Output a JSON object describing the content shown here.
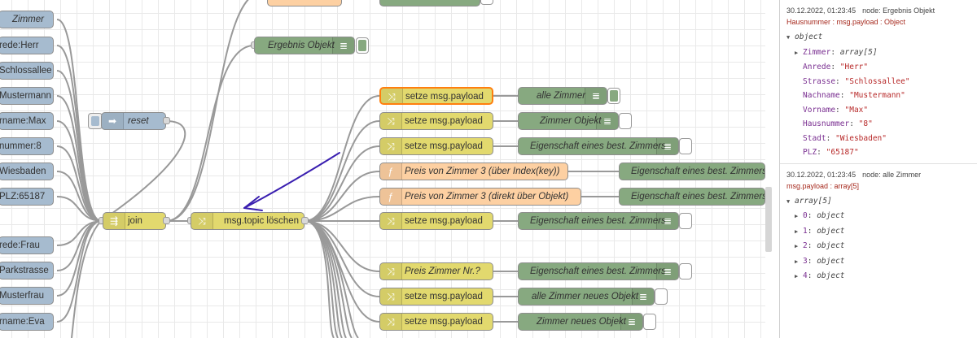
{
  "flow": {
    "inject_nodes": [
      "Zimmer",
      "rede:Herr",
      "Schlossallee",
      "Mustermann",
      "rname:Max",
      "nummer:8",
      "Wiesbaden",
      "PLZ:65187",
      "rede:Frau",
      "Parkstrasse",
      "Musterfrau",
      "rname:Eva"
    ],
    "reset_label": "reset",
    "join_label": "join",
    "clear_topic_label": "msg.topic löschen",
    "result_debug_label": "Ergebnis Objekt",
    "change_nodes": [
      "setze msg.payload",
      "setze msg.payload",
      "setze msg.payload",
      "setze msg.payload",
      "setze msg.payload",
      "setze msg.payload"
    ],
    "function_nodes": [
      "Preis von Zimmer 3 (über Index(key))",
      "Preis von Zimmer 3 (direkt über Objekt)",
      "Preis Zimmer Nr.?"
    ],
    "debug_nodes": [
      "alle Zimmer",
      "Zimmer Objekt",
      "Eigenschaft eines best. Zimmers",
      "Eigenschaft eines best. Zimmers",
      "Eigenschaft eines best. Zimmers",
      "Eigenschaft eines best. Zimmers",
      "Eigenschaft eines best. Zimmers",
      "alle Zimmer neues Objekt",
      "Zimmer neues Objekt"
    ]
  },
  "colors": {
    "inject": "#a6bbcf",
    "change": "#e2d96e",
    "function": "#fdd0a2",
    "debug": "#87a980",
    "selection": "#ff7f0e",
    "annotation_arrow": "#3a1fb0"
  },
  "debug_panel": {
    "msg1": {
      "timestamp": "30.12.2022, 01:23:45",
      "node": "node: Ergebnis Objekt",
      "topic": "Hausnummer : msg.payload : Object",
      "root": "object",
      "rows": [
        {
          "key": "Zimmer",
          "value": "array[5]"
        },
        {
          "key": "Anrede",
          "value": "\"Herr\""
        },
        {
          "key": "Strasse",
          "value": "\"Schlossallee\""
        },
        {
          "key": "Nachname",
          "value": "\"Mustermann\""
        },
        {
          "key": "Vorname",
          "value": "\"Max\""
        },
        {
          "key": "Hausnummer",
          "value": "\"8\""
        },
        {
          "key": "Stadt",
          "value": "\"Wiesbaden\""
        },
        {
          "key": "PLZ",
          "value": "\"65187\""
        }
      ]
    },
    "msg2": {
      "timestamp": "30.12.2022, 01:23:45",
      "node": "node: alle Zimmer",
      "topic": "msg.payload : array[5]",
      "root": "array[5]",
      "rows": [
        {
          "key": "0",
          "value": "object"
        },
        {
          "key": "1",
          "value": "object"
        },
        {
          "key": "2",
          "value": "object"
        },
        {
          "key": "3",
          "value": "object"
        },
        {
          "key": "4",
          "value": "object"
        }
      ]
    }
  }
}
